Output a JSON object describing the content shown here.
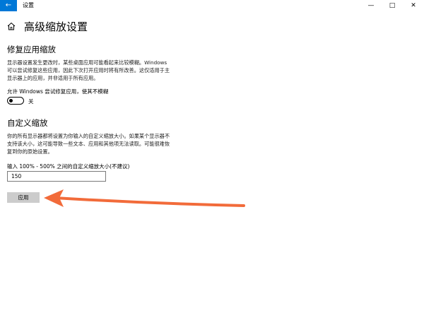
{
  "window": {
    "title": "设置",
    "back_glyph": "←",
    "minimize_glyph": "—",
    "maximize_glyph": "□",
    "close_glyph": "✕"
  },
  "header": {
    "title": "高级缩放设置",
    "icon": "home-icon"
  },
  "fix_section": {
    "title": "修复应用缩放",
    "description": "显示器设置发生更改时，某些桌面应用可能看起来比较模糊。Windows 可以尝试修复这些应用，因此下次打开应用时将有所改善。这仅适用于主显示器上的应用，并非适用于所有应用。",
    "toggle_label": "允许 Windows 尝试修复应用，使其不模糊",
    "toggle_state": "关"
  },
  "custom_section": {
    "title": "自定义缩放",
    "description": "你的所有显示器都将设置为你输入的自定义缩放大小。如果某个显示器不支持该大小，这可能导致一些文本、应用和其他项无法读取。可能很难恢复到你的原始设置。",
    "input_label": "输入 100% - 500% 之间的自定义缩放大小(不建议)",
    "input_value": "150",
    "apply_label": "应用"
  },
  "colors": {
    "accent": "#0078d7",
    "arrow": "#f26b3a",
    "button": "#cccccc"
  }
}
